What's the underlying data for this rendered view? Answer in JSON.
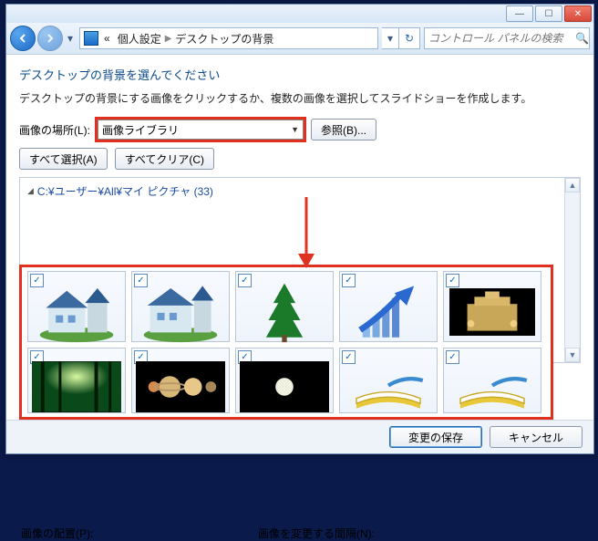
{
  "titlebar": {},
  "nav": {
    "crumb1": "個人設定",
    "crumb2": "デスクトップの背景",
    "search_placeholder": "コントロール パネルの検索"
  },
  "page": {
    "heading": "デスクトップの背景を選んでください",
    "desc": "デスクトップの背景にする画像をクリックするか、複数の画像を選択してスライドショーを作成します。",
    "location_label": "画像の場所(L):",
    "location_value": "画像ライブラリ",
    "browse_btn": "参照(B)...",
    "select_all_btn": "すべて選択(A)",
    "clear_all_btn": "すべてクリア(C)",
    "group_path": "C:¥ユーザー¥All¥マイ ピクチャ (33)",
    "position_label": "画像の配置(P):",
    "interval_label": "画像を変更する間隔(N):"
  },
  "footer": {
    "save": "変更の保存",
    "cancel": "キャンセル"
  },
  "thumbs": [
    {
      "checked": true,
      "kind": "house"
    },
    {
      "checked": true,
      "kind": "house"
    },
    {
      "checked": true,
      "kind": "tree"
    },
    {
      "checked": true,
      "kind": "arrow"
    },
    {
      "checked": true,
      "kind": "palace"
    },
    {
      "checked": true,
      "kind": "forest"
    },
    {
      "checked": true,
      "kind": "planets"
    },
    {
      "checked": true,
      "kind": "moon"
    },
    {
      "checked": true,
      "kind": "book"
    },
    {
      "checked": true,
      "kind": "book"
    }
  ]
}
